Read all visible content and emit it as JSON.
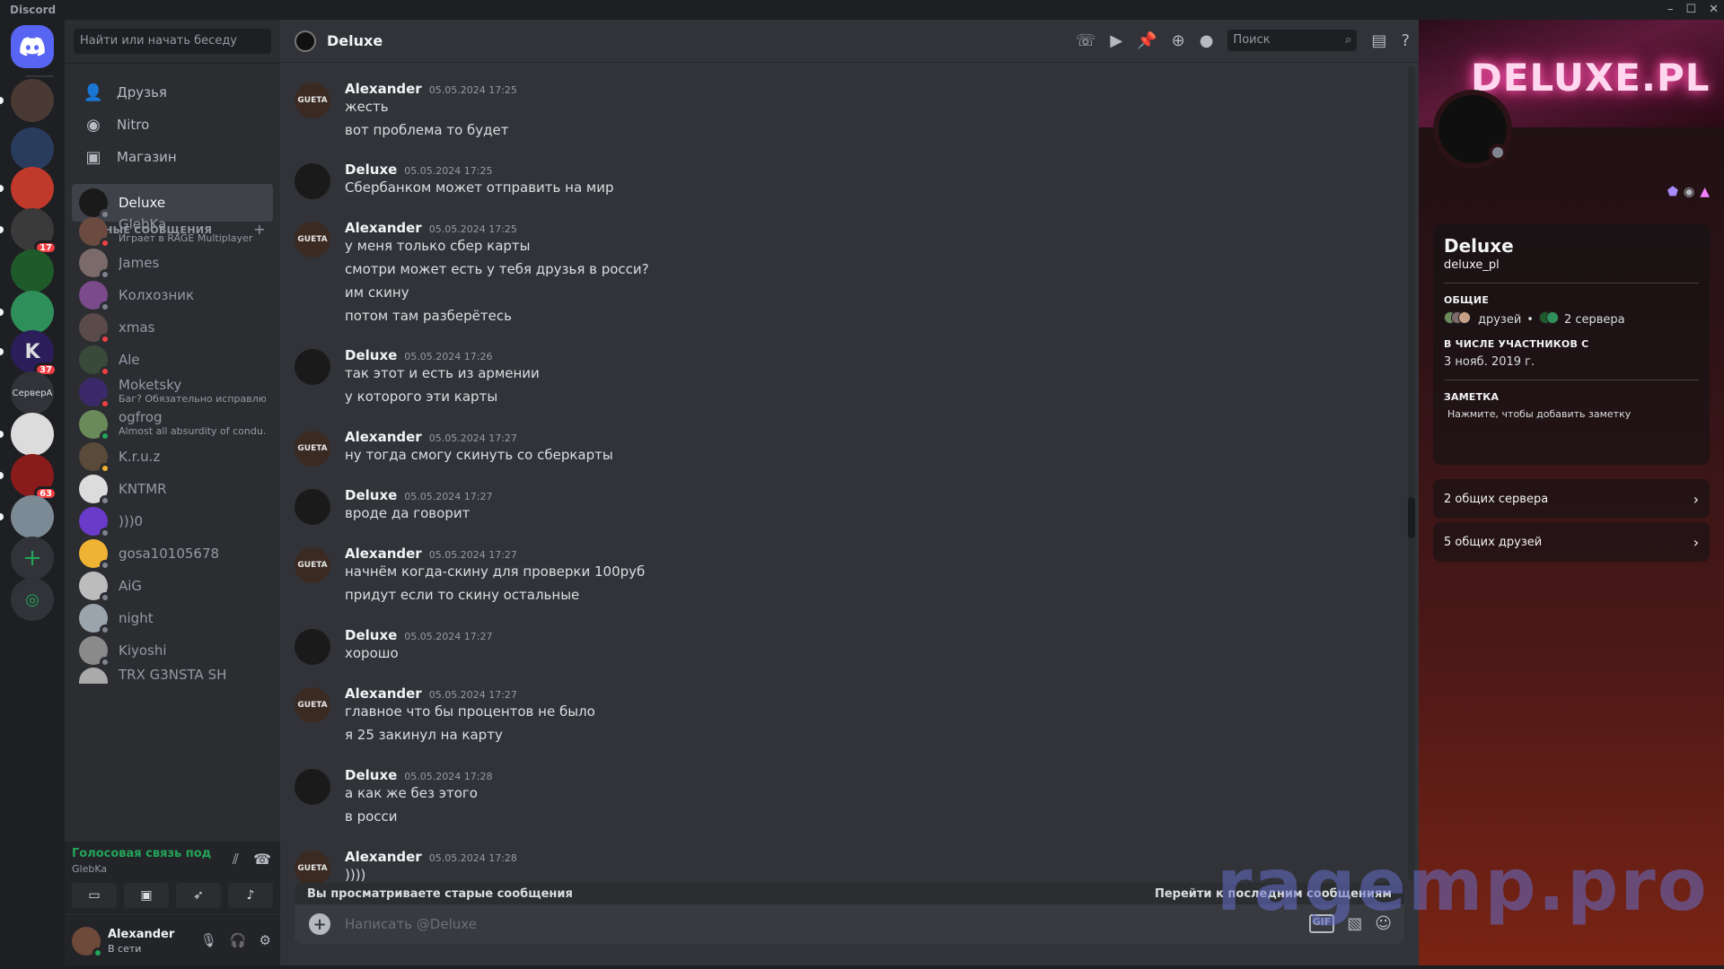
{
  "window": {
    "title": "Discord",
    "controls": [
      "–",
      "☐",
      "✕"
    ]
  },
  "guilds": [
    {
      "label": "",
      "color": "#5865f2",
      "icon": "discord-logo-icon"
    },
    {
      "label": "",
      "color": "#4a3a34"
    },
    {
      "label": "",
      "color": "#2a3c5e"
    },
    {
      "label": "",
      "color": "#c0392b"
    },
    {
      "label": "",
      "color": "#3a3a3a",
      "badge": "17"
    },
    {
      "label": "",
      "color": "#1f5a2a"
    },
    {
      "label": "",
      "color": "#2f8f5a"
    },
    {
      "label": "K",
      "color": "#2b1e5a",
      "badge": "37"
    },
    {
      "label": "СерверА",
      "color": "#313338"
    },
    {
      "label": "",
      "color": "#dcdcdc"
    },
    {
      "label": "",
      "color": "#8a1b1b",
      "badge": "63"
    },
    {
      "label": "",
      "color": "#7c8a95"
    }
  ],
  "dm": {
    "search_placeholder": "Найти или начать беседу",
    "nav": [
      {
        "label": "Друзья",
        "icon": "friends-icon"
      },
      {
        "label": "Nitro",
        "icon": "nitro-icon"
      },
      {
        "label": "Магазин",
        "icon": "shop-icon"
      }
    ],
    "section_title": "ЛИЧНЫЕ СООБЩЕНИЯ",
    "section_plus": "+",
    "items": [
      {
        "name": "Deluxe",
        "sub": "",
        "color": "#1a1a1a",
        "status": "#80848e",
        "active": true
      },
      {
        "name": "GlebKa",
        "sub": "Играет в RAGE Multiplayer",
        "color": "#6b4a3f",
        "status": "#f23f43"
      },
      {
        "name": "James",
        "sub": "",
        "color": "#7a6a6a",
        "status": "#80848e"
      },
      {
        "name": "Колхозник",
        "sub": "",
        "color": "#7a4a8a",
        "status": "#80848e"
      },
      {
        "name": "xmas",
        "sub": "",
        "color": "#5a4a4a",
        "status": "#f23f43"
      },
      {
        "name": "Ale",
        "sub": "",
        "color": "#3a4a3a",
        "status": "#f23f43"
      },
      {
        "name": "Moketsky",
        "sub": "Баг? Обязательно исправлю...",
        "color": "#3a2a6a",
        "status": "#f23f43"
      },
      {
        "name": "ogfrog",
        "sub": "Almost all absurdity of condu...",
        "color": "#6a8a5a",
        "status": "#23a559"
      },
      {
        "name": "K.r.u.z",
        "sub": "",
        "color": "#5a4a3a",
        "status": "#f0b232"
      },
      {
        "name": "KNTMR",
        "sub": "",
        "color": "#dcdcdc",
        "status": "#80848e"
      },
      {
        "name": ")))0",
        "sub": "",
        "color": "#6a3ac8",
        "status": "#80848e"
      },
      {
        "name": "gosa10105678",
        "sub": "",
        "color": "#f0b232",
        "status": "#80848e"
      },
      {
        "name": "AiG",
        "sub": "",
        "color": "#bcbcbc",
        "status": "#80848e"
      },
      {
        "name": "night",
        "sub": "",
        "color": "#9aa4ac",
        "status": "#80848e"
      },
      {
        "name": "Kiyoshi",
        "sub": "",
        "color": "#8a8a8a",
        "status": "#80848e"
      },
      {
        "name": "TRX G3NSTA SH",
        "sub": "",
        "color": "#aaaaaa",
        "status": "#80848e"
      }
    ]
  },
  "voice": {
    "status": "Голосовая связь под",
    "channel": "GlebKa"
  },
  "user": {
    "name": "Alexander",
    "status": "В сети"
  },
  "chat": {
    "title": "Deluxe",
    "search_placeholder": "Поиск",
    "messages": [
      {
        "author": "Alexander",
        "time": "05.05.2024 17:25",
        "lines": [
          "жесть",
          "вот проблема то будет"
        ]
      },
      {
        "author": "Deluxe",
        "time": "05.05.2024 17:25",
        "lines": [
          "Сбербанком может отправить на мир"
        ]
      },
      {
        "author": "Alexander",
        "time": "05.05.2024 17:25",
        "lines": [
          "у меня только сбер карты",
          "смотри может есть у тебя друзья в росси?",
          "им скину",
          "потом там разберётесь"
        ]
      },
      {
        "author": "Deluxe",
        "time": "05.05.2024 17:26",
        "lines": [
          "так этот и есть из армении",
          "у которого эти карты"
        ]
      },
      {
        "author": "Alexander",
        "time": "05.05.2024 17:27",
        "lines": [
          "ну тогда смогу скинуть со сберкарты"
        ]
      },
      {
        "author": "Deluxe",
        "time": "05.05.2024 17:27",
        "lines": [
          "вроде да говорит"
        ]
      },
      {
        "author": "Alexander",
        "time": "05.05.2024 17:27",
        "lines": [
          "начнём когда-скину для проверки 100руб",
          "придут если то скину остальные"
        ]
      },
      {
        "author": "Deluxe",
        "time": "05.05.2024 17:27",
        "lines": [
          "хорошо"
        ]
      },
      {
        "author": "Alexander",
        "time": "05.05.2024 17:27",
        "lines": [
          "главное что бы процентов не было",
          "я 25 закинул на карту"
        ]
      },
      {
        "author": "Deluxe",
        "time": "05.05.2024 17:28",
        "lines": [
          "а как же без этого",
          "в росси"
        ]
      },
      {
        "author": "Alexander",
        "time": "05.05.2024 17:28",
        "lines": [
          "))))"
        ]
      }
    ],
    "old_bar_left": "Вы просматриваете старые сообщения",
    "old_bar_right": "Перейти к последним сообщениям",
    "composer_placeholder": "Написать @Deluxe",
    "composer_plus": "+",
    "gif_label": "GIF"
  },
  "profile": {
    "banner_text": "DELUXE.PL",
    "name": "Deluxe",
    "username": "deluxe_pl",
    "common_title": "ОБЩИЕ",
    "friends_label": "друзей",
    "servers_label": "2 сервера",
    "member_since_title": "В ЧИСЛЕ УЧАСТНИКОВ С",
    "member_since": "3 нояб. 2019 г.",
    "note_title": "ЗАМЕТКА",
    "note_placeholder": "Нажмите, чтобы добавить заметку",
    "rows": [
      "2 общих сервера",
      "5 общих друзей"
    ]
  },
  "watermark": "ragemp.pro"
}
